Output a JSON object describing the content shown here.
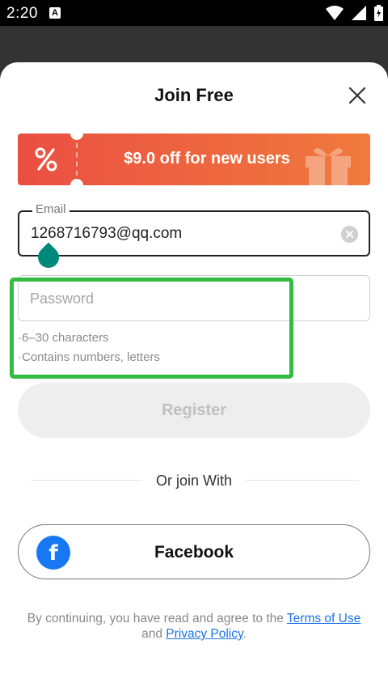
{
  "status_bar": {
    "time": "2:20",
    "notification_icon": "A"
  },
  "header": {
    "title": "Join Free",
    "close_icon": "close-icon"
  },
  "promo": {
    "text": "$9.0 off for new users",
    "colors": {
      "start": "#ea4f42",
      "end": "#f07a3d"
    }
  },
  "email": {
    "label": "Email",
    "value": "1268716793@qq.com"
  },
  "password": {
    "placeholder": "Password",
    "hints": [
      "·6–30 characters",
      "·Contains numbers, letters"
    ]
  },
  "register": {
    "label": "Register"
  },
  "social": {
    "divider_text": "Or join With",
    "facebook_label": "Facebook",
    "facebook_glyph": "f",
    "facebook_color": "#1877f2"
  },
  "legal": {
    "prefix": "By continuing, you have read and agree to the ",
    "terms": "Terms of Use",
    "and": " and ",
    "privacy": "Privacy Policy",
    "suffix": "."
  },
  "accent": {
    "highlight": "#33bb44",
    "link": "#1a73e8",
    "cursor": "#00897b"
  }
}
